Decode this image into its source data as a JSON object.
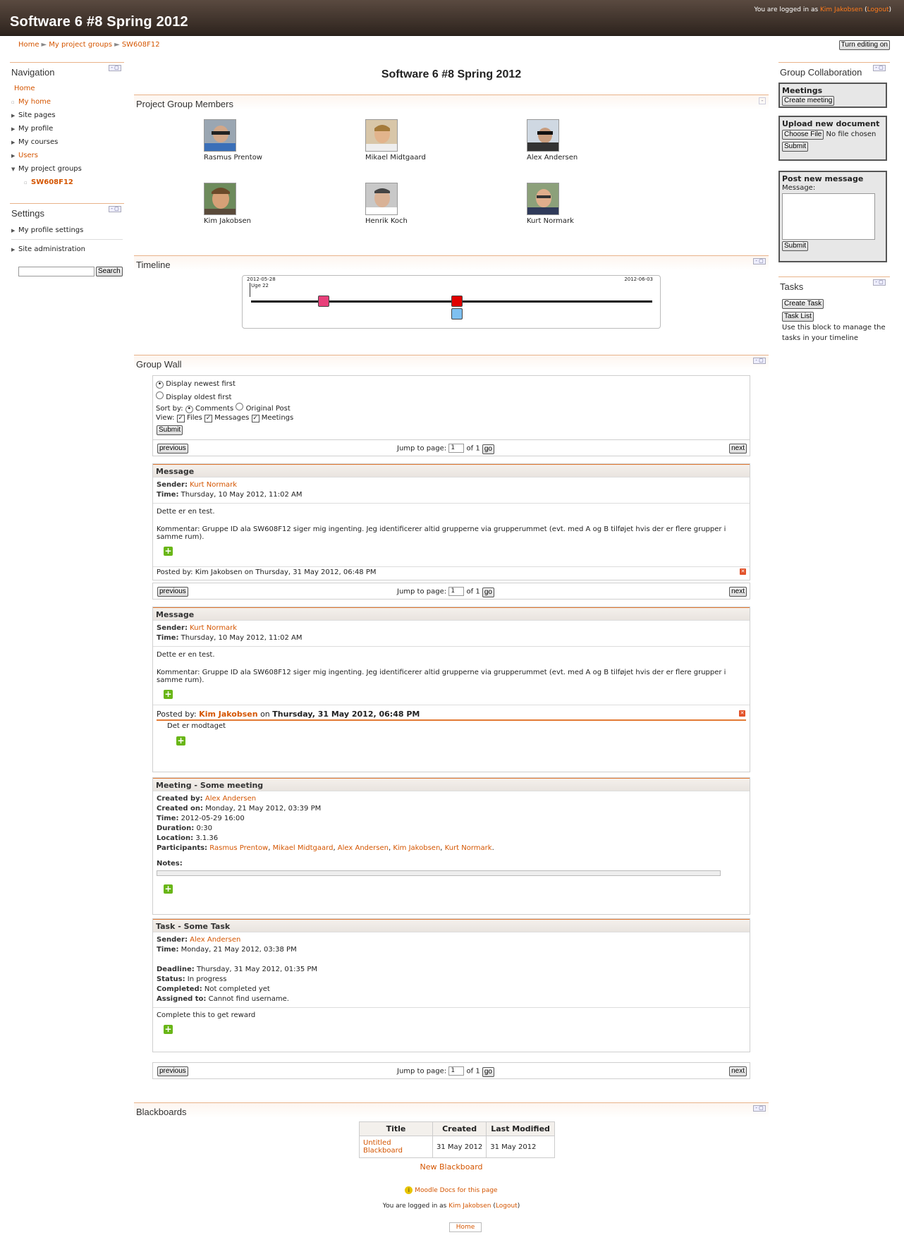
{
  "header": {
    "site_title": "Software 6 #8 Spring 2012",
    "logged_in_prefix": "You are logged in as",
    "user": "Kim Jakobsen",
    "logout": "Logout"
  },
  "breadcrumb": [
    "Home",
    "My project groups",
    "SW608F12"
  ],
  "turn_editing": "Turn editing on",
  "page_title": "Software 6 #8 Spring 2012",
  "navigation": {
    "title": "Navigation",
    "home": "Home",
    "items": [
      "My home",
      "Site pages",
      "My profile",
      "My courses",
      "Users",
      "My project groups"
    ],
    "sub_item": "SW608F12"
  },
  "settings": {
    "title": "Settings",
    "items": [
      "My profile settings",
      "Site administration"
    ],
    "search_button": "Search"
  },
  "members": {
    "title": "Project Group Members",
    "list": [
      "Rasmus Prentow",
      "Mikael Midtgaard",
      "Alex Andersen",
      "Kim Jakobsen",
      "Henrik Koch",
      "Kurt Normark"
    ]
  },
  "timeline": {
    "title": "Timeline",
    "start_date": "2012-05-28",
    "end_date": "2012-06-03",
    "week_label": "Uge 22",
    "colors": {
      "pink": "#e8407a",
      "red": "#e00000",
      "blue": "#7ec0f0"
    }
  },
  "wall": {
    "title": "Group Wall",
    "display_newest": "Display newest first",
    "display_oldest": "Display oldest first",
    "sort_by": "Sort by:",
    "sort_comments": "Comments",
    "sort_original": "Original Post",
    "view": "View:",
    "view_files": "Files",
    "view_messages": "Messages",
    "view_meetings": "Meetings",
    "submit": "Submit",
    "previous": "previous",
    "next": "next",
    "jump_to_page": "Jump to page:",
    "page_value": "1",
    "of": "of 1",
    "go": "go"
  },
  "message1": {
    "head": "Message",
    "sender_label": "Sender:",
    "sender": "Kurt Normark",
    "time_label": "Time:",
    "time": "Thursday, 10 May 2012, 11:02 AM",
    "body1": "Dette er en test.",
    "body2": "Kommentar: Gruppe ID ala SW608F12 siger mig ingenting. Jeg identificerer altid grupperne via grupperummet (evt. med A og B tilføjet hvis der er flere grupper i samme rum).",
    "comment_cut": "Posted by: Kim Jakobsen on Thursday, 31 May 2012, 06:48 PM"
  },
  "message2": {
    "head": "Message",
    "sender_label": "Sender:",
    "sender": "Kurt Normark",
    "time_label": "Time:",
    "time": "Thursday, 10 May 2012, 11:02 AM",
    "body1": "Dette er en test.",
    "body2": "Kommentar: Gruppe ID ala SW608F12 siger mig ingenting. Jeg identificerer altid grupperne via grupperummet (evt. med A og B tilføjet hvis der er flere grupper i samme rum).",
    "posted_by_label": "Posted by:",
    "posted_by": "Kim Jakobsen",
    "on": "on",
    "posted_time": "Thursday, 31 May 2012, 06:48 PM",
    "comment": "Det er modtaget"
  },
  "meeting": {
    "head": "Meeting - Some meeting",
    "created_by_label": "Created by:",
    "created_by": "Alex Andersen",
    "created_on_label": "Created on:",
    "created_on": "Monday, 21 May 2012, 03:39 PM",
    "time_label": "Time:",
    "time": "2012-05-29 16:00",
    "duration_label": "Duration:",
    "duration": "0:30",
    "location_label": "Location:",
    "location": "3.1.36",
    "participants_label": "Participants:",
    "participants": [
      "Rasmus Prentow",
      "Mikael Midtgaard",
      "Alex Andersen",
      "Kim Jakobsen",
      "Kurt Normark"
    ],
    "notes_label": "Notes:"
  },
  "task": {
    "head": "Task - Some Task",
    "sender_label": "Sender:",
    "sender": "Alex Andersen",
    "time_label": "Time:",
    "time": "Monday, 21 May 2012, 03:38 PM",
    "deadline_label": "Deadline:",
    "deadline": "Thursday, 31 May 2012, 01:35 PM",
    "status_label": "Status:",
    "status": "In progress",
    "completed_label": "Completed:",
    "completed": "Not completed yet",
    "assigned_label": "Assigned to:",
    "assigned": "Cannot find username.",
    "description": "Complete this to get reward"
  },
  "blackboards": {
    "title": "Blackboards",
    "columns": [
      "Title",
      "Created",
      "Last Modified"
    ],
    "rows": [
      [
        "Untitled Blackboard",
        "31 May 2012",
        "31 May 2012"
      ]
    ],
    "new_link": "New Blackboard"
  },
  "right": {
    "collab_title": "Group Collaboration",
    "meetings": "Meetings",
    "create_meeting": "Create meeting",
    "upload_title": "Upload new document",
    "choose_file": "Choose File",
    "no_file": "No file chosen",
    "submit": "Submit",
    "post_title": "Post new message",
    "message_label": "Message:",
    "tasks_title": "Tasks",
    "create_task": "Create Task",
    "task_list": "Task List",
    "tasks_desc": "Use this block to manage the tasks in your timeline"
  },
  "footer": {
    "docs": "Moodle Docs for this page",
    "logged_in_prefix": "You are logged in as",
    "user": "Kim Jakobsen",
    "logout": "Logout",
    "home": "Home"
  }
}
